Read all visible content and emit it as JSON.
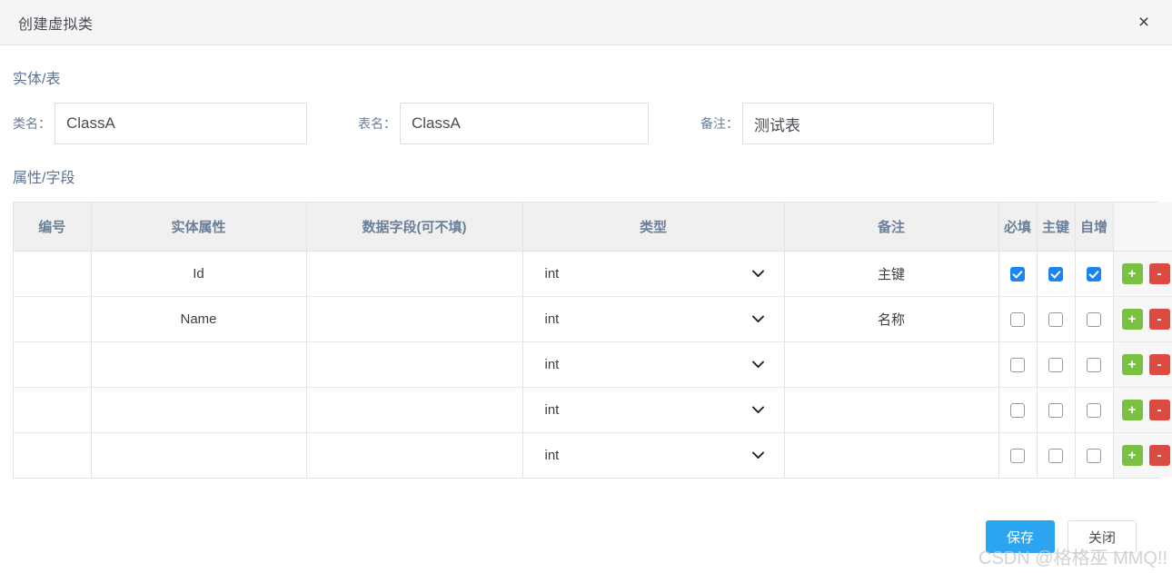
{
  "dialog": {
    "title": "创建虚拟类",
    "close_icon": "close-icon",
    "close_label": "×"
  },
  "entity_section": {
    "title": "实体/表",
    "class_name": {
      "label": "类名：",
      "value": "ClassA"
    },
    "table_name": {
      "label": "表名：",
      "value": "ClassA"
    },
    "remark": {
      "label": "备注：",
      "value": "测试表"
    }
  },
  "fields_section": {
    "title": "属性/字段",
    "columns": {
      "no": "编号",
      "attribute": "实体属性",
      "data_field": "数据字段(可不填)",
      "type": "类型",
      "remark": "备注",
      "required": "必填",
      "primary_key": "主键",
      "auto_increment": "自增",
      "actions": ""
    },
    "rows": [
      {
        "no": "",
        "attribute": "Id",
        "data_field": "",
        "type": "int",
        "remark": "主键",
        "required": true,
        "primary_key": true,
        "auto_increment": true,
        "add_label": "+",
        "del_label": "-"
      },
      {
        "no": "",
        "attribute": "Name",
        "data_field": "",
        "type": "int",
        "remark": "名称",
        "required": false,
        "primary_key": false,
        "auto_increment": false,
        "add_label": "+",
        "del_label": "-"
      },
      {
        "no": "",
        "attribute": "",
        "data_field": "",
        "type": "int",
        "remark": "",
        "required": false,
        "primary_key": false,
        "auto_increment": false,
        "add_label": "+",
        "del_label": "-"
      },
      {
        "no": "",
        "attribute": "",
        "data_field": "",
        "type": "int",
        "remark": "",
        "required": false,
        "primary_key": false,
        "auto_increment": false,
        "add_label": "+",
        "del_label": "-"
      },
      {
        "no": "",
        "attribute": "",
        "data_field": "",
        "type": "int",
        "remark": "",
        "required": false,
        "primary_key": false,
        "auto_increment": false,
        "add_label": "+",
        "del_label": "-"
      }
    ]
  },
  "footer": {
    "save_label": "保存",
    "close_label": "关闭"
  },
  "watermark": {
    "text": "CSDN @格格巫 MMQ!!"
  },
  "colors": {
    "primary": "#2ca5f0",
    "checkbox_checked": "#1a84f5",
    "add_button": "#7ac143",
    "delete_button": "#dc4b42",
    "header_bg": "#f5f5f5",
    "table_header_bg": "#f0f0f0",
    "section_title": "#5a7391"
  }
}
